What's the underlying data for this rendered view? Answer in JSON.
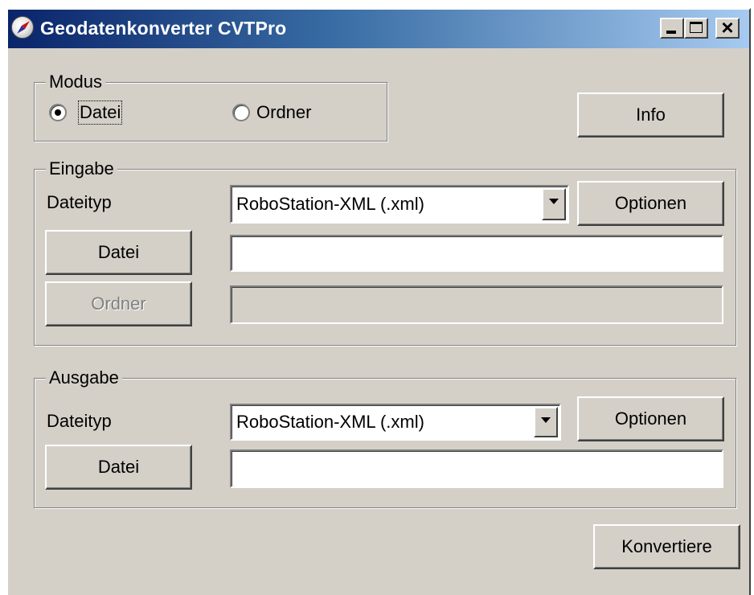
{
  "window": {
    "title": "Geodatenkonverter CVTPro",
    "close_glyph": "×"
  },
  "modus": {
    "label": "Modus",
    "options": [
      {
        "label": "Datei",
        "selected": true
      },
      {
        "label": "Ordner",
        "selected": false
      }
    ]
  },
  "info_button": {
    "label": "Info"
  },
  "eingabe": {
    "label": "Eingabe",
    "dateityp_label": "Dateityp",
    "dateityp_value": "RoboStation-XML (.xml)",
    "optionen_label": "Optionen",
    "datei_button": "Datei",
    "datei_value": "",
    "ordner_button": "Ordner",
    "ordner_value": ""
  },
  "ausgabe": {
    "label": "Ausgabe",
    "dateityp_label": "Dateityp",
    "dateityp_value": "RoboStation-XML (.xml)",
    "optionen_label": "Optionen",
    "datei_button": "Datei",
    "datei_value": ""
  },
  "konvertiere_button": {
    "label": "Konvertiere"
  },
  "colors": {
    "titlebar_start": "#0a246a",
    "titlebar_end": "#a6caf0",
    "face": "#d4d0c8",
    "disabled_text": "#808080"
  },
  "icons": {
    "app": "compass-icon",
    "minimize": "minimize-icon",
    "maximize": "maximize-icon",
    "close": "close-icon",
    "dropdown": "chevron-down-icon"
  }
}
